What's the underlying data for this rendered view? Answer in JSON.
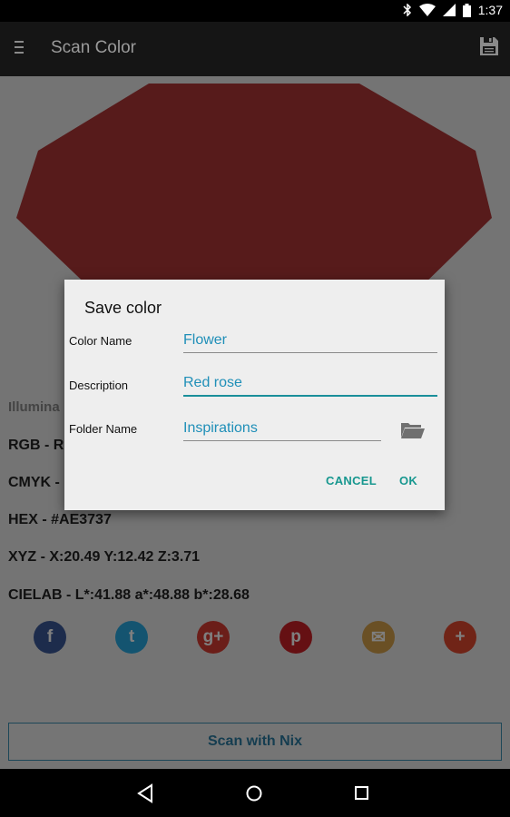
{
  "status_bar": {
    "time": "1:37",
    "icons": [
      "bluetooth-icon",
      "wifi-icon",
      "signal-icon",
      "battery-icon"
    ]
  },
  "app_bar": {
    "title": "Scan Color",
    "menu_icon": "hamburger-icon",
    "save_icon": "floppy-disk-icon"
  },
  "swatch": {
    "color": "#AE3737"
  },
  "color_info": {
    "illuminant": "Illumina",
    "rgb": "RGB - R:",
    "cmyk": "CMYK -",
    "hex": "HEX - #AE3737",
    "xyz": "XYZ - X:20.49 Y:12.42 Z:3.71",
    "cielab": "CIELAB - L*:41.88 a*:48.88 b*:28.68"
  },
  "share": [
    {
      "name": "facebook",
      "glyph": "f",
      "color": "#3b5998"
    },
    {
      "name": "twitter",
      "glyph": "t",
      "color": "#29a9e1"
    },
    {
      "name": "google-plus",
      "glyph": "g+",
      "color": "#d73d32"
    },
    {
      "name": "pinterest",
      "glyph": "p",
      "color": "#cb2027"
    },
    {
      "name": "email",
      "glyph": "✉",
      "color": "#d4a04a"
    },
    {
      "name": "more",
      "glyph": "+",
      "color": "#e0492f"
    }
  ],
  "scan_button": {
    "label": "Scan with Nix"
  },
  "dialog": {
    "title": "Save color",
    "fields": {
      "color_name": {
        "label": "Color Name",
        "value": "Flower"
      },
      "description": {
        "label": "Description",
        "value": "Red rose"
      },
      "folder_name": {
        "label": "Folder Name",
        "value": "Inspirations"
      }
    },
    "cancel_label": "CANCEL",
    "ok_label": "OK",
    "accent_color": "#17978F"
  },
  "nav_bar": {
    "back_icon": "back-triangle-icon",
    "home_icon": "home-circle-icon",
    "recents_icon": "recents-square-icon"
  }
}
